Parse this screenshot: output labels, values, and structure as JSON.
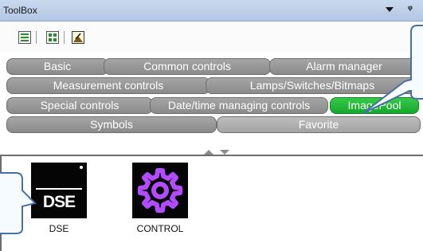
{
  "window": {
    "title": "ToolBox"
  },
  "toolbar": {
    "icons": [
      "grid-view-icon",
      "list-view-icon",
      "picture-icon"
    ]
  },
  "tabs": {
    "row1": [
      "Basic",
      "Common controls",
      "Alarm manager"
    ],
    "row2": [
      "Measurement controls",
      "Lamps/Switches/Bitmaps"
    ],
    "row3": [
      "Special controls",
      "Date/time managing controls",
      "ImagePool"
    ],
    "row4": [
      "Symbols",
      "Favorite"
    ],
    "active": "ImagePool"
  },
  "items": [
    {
      "label": "DSE",
      "logo_text": "DSE",
      "icon": "dse-logo-icon"
    },
    {
      "label": "CONTROL",
      "icon": "gear-icon"
    }
  ],
  "colors": {
    "active_tab": "#1fb533",
    "tab": "#999999",
    "gear": "#b24cff"
  }
}
